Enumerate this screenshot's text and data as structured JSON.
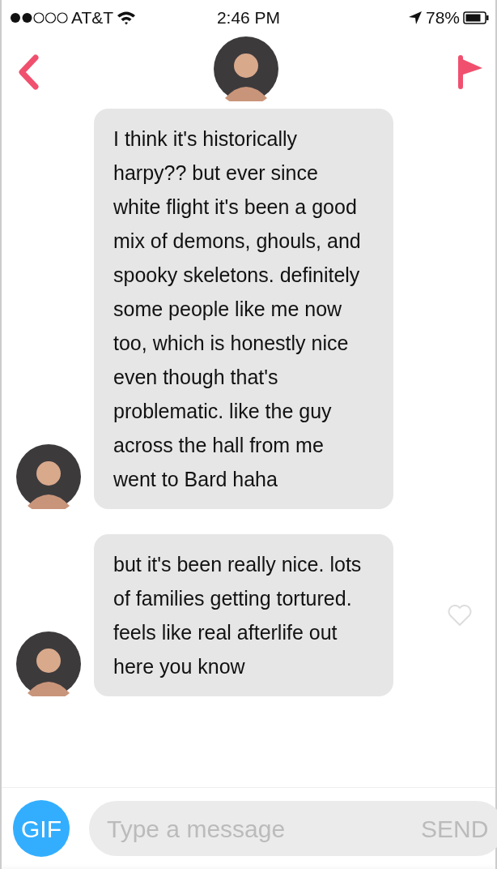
{
  "status_bar": {
    "carrier": "AT&T",
    "time": "2:46 PM",
    "battery": "78%"
  },
  "messages": [
    {
      "text": "I think it's historically harpy?? but ever since white flight it's been a good mix of demons, ghouls, and spooky skeletons. definitely some people like me now too, which is honestly nice even though that's problematic. like the guy across the hall from me went to Bard haha"
    },
    {
      "text": "but it's been really nice. lots of families getting tortured. feels like real afterlife out here you know",
      "liked": false
    }
  ],
  "composer": {
    "gif_label": "GIF",
    "placeholder": "Type a message",
    "send_label": "SEND"
  }
}
